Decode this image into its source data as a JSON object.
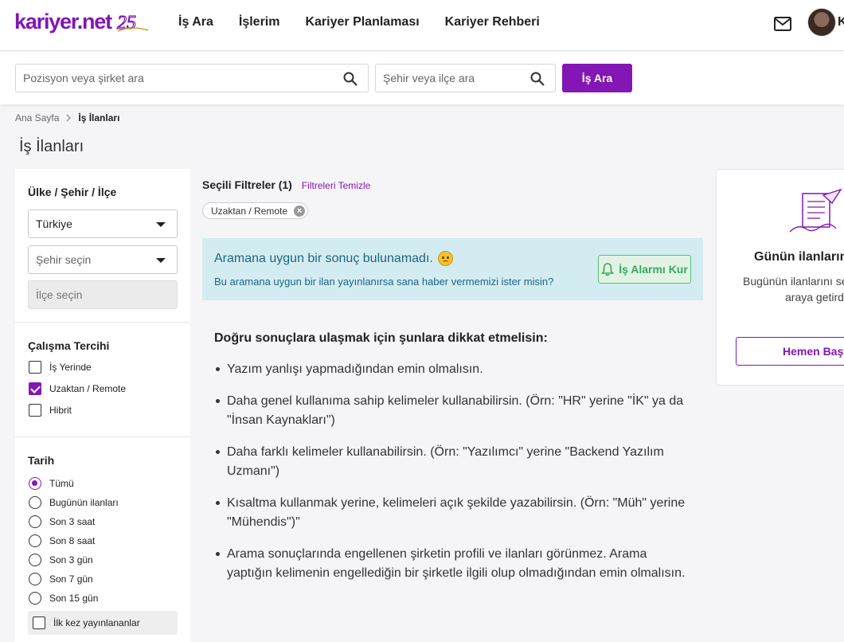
{
  "header": {
    "logo_text": "kariyer.net",
    "logo_badge": "25",
    "nav": [
      "İş Ara",
      "İşlerim",
      "Kariyer Planlaması",
      "Kariyer Rehberi"
    ],
    "user_initial": "K"
  },
  "search": {
    "position_placeholder": "Pozisyon veya şirket ara",
    "city_placeholder": "Şehir veya ilçe ara",
    "button_label": "İş Ara"
  },
  "breadcrumb": {
    "home": "Ana Sayfa",
    "current": "İş İlanları"
  },
  "page_title": "İş İlanları",
  "sidebar": {
    "location_title": "Ülke / Şehir / İlçe",
    "country_value": "Türkiye",
    "city_placeholder": "Şehir seçin",
    "district_placeholder": "İlçe seçin",
    "work_pref_title": "Çalışma Tercihi",
    "work_prefs": [
      {
        "label": "İş Yerinde",
        "checked": false
      },
      {
        "label": "Uzaktan / Remote",
        "checked": true
      },
      {
        "label": "Hibrit",
        "checked": false
      }
    ],
    "date_title": "Tarih",
    "date_options": [
      {
        "label": "Tümü",
        "checked": true
      },
      {
        "label": "Bugünün ilanları",
        "checked": false
      },
      {
        "label": "Son 3 saat",
        "checked": false
      },
      {
        "label": "Son 8 saat",
        "checked": false
      },
      {
        "label": "Son 3 gün",
        "checked": false
      },
      {
        "label": "Son 7 gün",
        "checked": false
      },
      {
        "label": "Son 15 gün",
        "checked": false
      }
    ],
    "first_published_label": "İlk kez yayınlananlar"
  },
  "filters": {
    "title": "Seçili Filtreler (1)",
    "clear_label": "Filtreleri Temizle",
    "chip_label": "Uzaktan / Remote"
  },
  "no_result": {
    "title": "Aramana uygun bir sonuç bulunamadı.",
    "subtitle": "Bu aramana uygun bir ilan yayınlanırsa sana haber vermemizi ister misin?",
    "alarm_button": "İş Alarmı Kur"
  },
  "tips": {
    "title": "Doğru sonuçlara ulaşmak için şunlara dikkat etmelisin:",
    "items": [
      "Yazım yanlışı yapmadığından emin olmalısın.",
      "Daha genel kullanıma sahip kelimeler kullanabilirsin. (Örn: \"HR\" yerine \"İK\" ya da \"İnsan Kaynakları\")",
      "Daha farklı kelimeler kullanabilirsin. (Örn: \"Yazılımcı\" yerine \"Backend Yazılım Uzmanı\")",
      "Kısaltma kullanmak yerine, kelimeleri açık şekilde yazabilirsin. (Örn: \"Müh\" yerine \"Mühendis\")\"",
      "Arama sonuçlarında engellenen şirketin profili ve ilanları görünmez. Arama yaptığın kelimenin engellediğin bir şirketle ilgili olup olmadığından emin olmalısın."
    ]
  },
  "right_card": {
    "title": "Günün ilanlarını",
    "desc_line1": "Bugünün ilanlarını se",
    "desc_line2": "araya getird",
    "button": "Hemen Başv"
  },
  "colors": {
    "brand": "#8316b5",
    "info_bg": "#d3ecf2",
    "success": "#3aa85c"
  }
}
